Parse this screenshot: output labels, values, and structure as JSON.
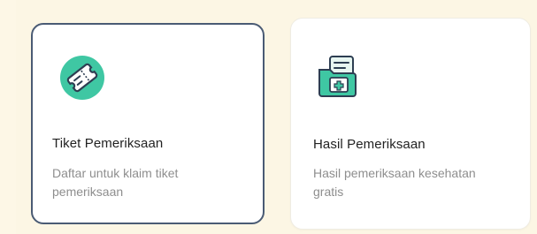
{
  "cards": [
    {
      "title": "Tiket Pemeriksaan",
      "description": "Daftar untuk klaim tiket pemeriksaan",
      "icon": "ticket-icon",
      "selected": true
    },
    {
      "title": "Hasil Pemeriksaan",
      "description": "Hasil pemeriksaan kesehatan gratis",
      "icon": "medical-folder-icon",
      "selected": false
    }
  ],
  "colors": {
    "background": "#fdf7e6",
    "selected_border": "#4a5b74",
    "icon_green": "#3fc7a3",
    "title_text": "#222222",
    "description_text": "#8e8e8e"
  }
}
